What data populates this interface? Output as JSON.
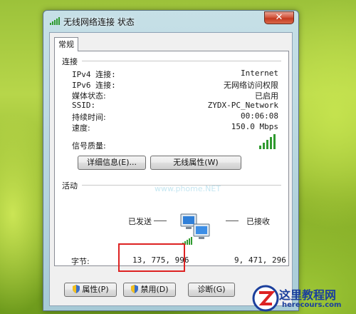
{
  "window": {
    "title": "无线网络连接 状态",
    "close_glyph": "✕"
  },
  "tab": "常规",
  "connection": {
    "section_label": "连接",
    "rows": [
      {
        "label": "IPv4 连接:",
        "value": "Internet"
      },
      {
        "label": "IPv6 连接:",
        "value": "无网络访问权限"
      },
      {
        "label": "媒体状态:",
        "value": "已启用"
      },
      {
        "label": "SSID:",
        "value": "ZYDX-PC_Network"
      },
      {
        "label": "持续时间:",
        "value": "00:06:08"
      },
      {
        "label": "速度:",
        "value": "150.0 Mbps"
      }
    ],
    "signal_label": "信号质量:",
    "signal_bars": 5,
    "details_button": "详细信息(E)...",
    "wireless_props_button": "无线属性(W)"
  },
  "activity": {
    "section_label": "活动",
    "sent_label": "已发送",
    "received_label": "已接收",
    "bytes_label": "字节:",
    "bytes_sent": "13, 775, 996",
    "bytes_received": "9, 471, 296"
  },
  "buttons": {
    "properties": "属性(P)",
    "disable": "禁用(D)",
    "diagnose": "诊断(G)"
  },
  "watermark": "www.phome.NET",
  "logo": {
    "text": "这里教程网",
    "url": "herecours.com"
  },
  "colors": {
    "highlight": "#dd2222",
    "signal": "#2f9a2f"
  }
}
